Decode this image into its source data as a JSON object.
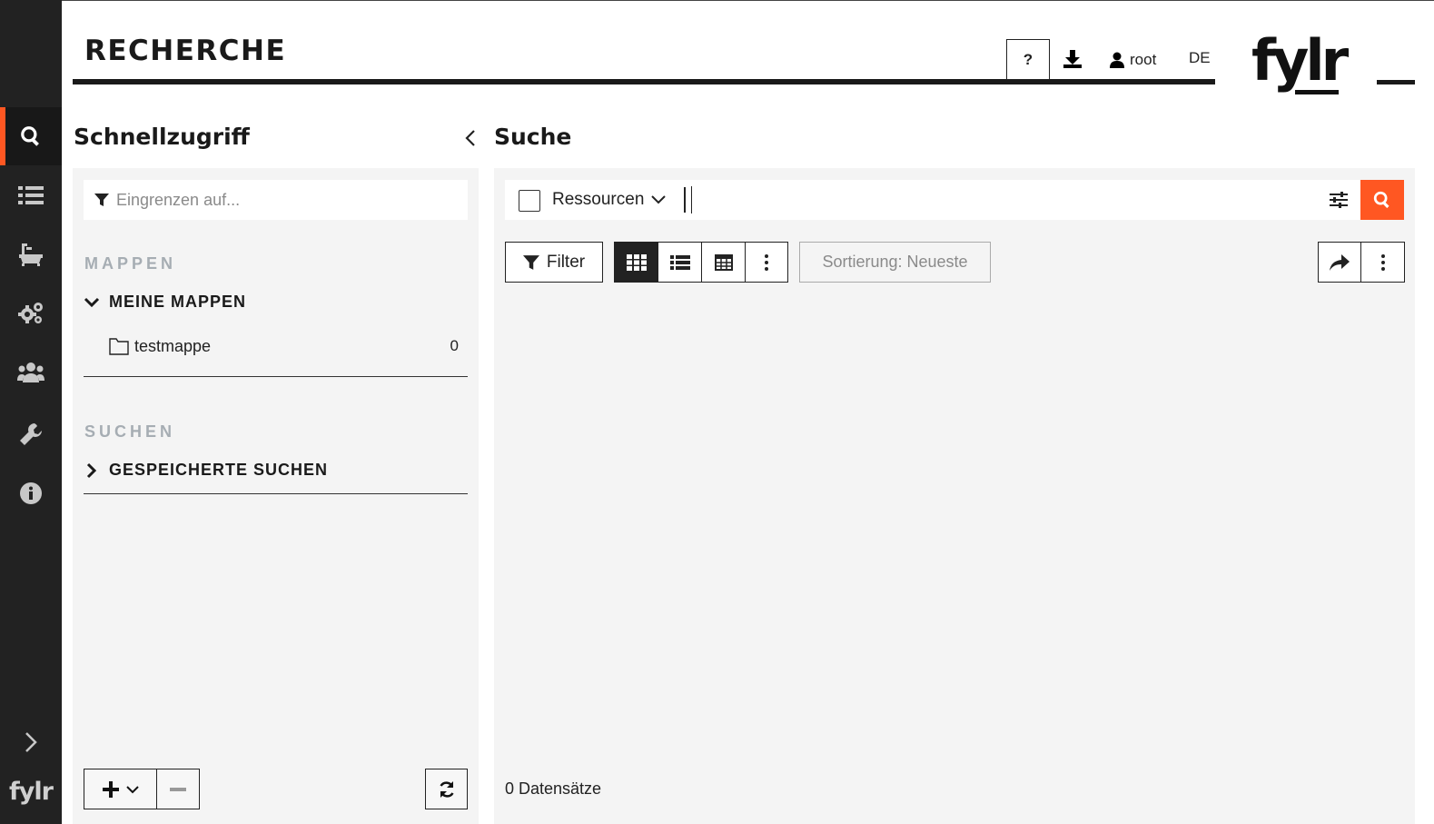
{
  "header": {
    "title": "RECHERCHE",
    "help_label": "?",
    "user_name": "root",
    "language": "DE",
    "brand": "fylr"
  },
  "rail": {
    "items": [
      "search-icon",
      "list-icon",
      "bathtub-icon",
      "cogs-icon",
      "users-icon",
      "wrench-icon",
      "info-icon"
    ],
    "active": "search-icon",
    "logo": "fylr"
  },
  "quick_access": {
    "title": "Schnellzugriff",
    "filter_placeholder": "Eingrenzen auf...",
    "folders_section": "MAPPEN",
    "my_folders_label": "MEINE MAPPEN",
    "folders": [
      {
        "name": "testmappe",
        "count": "0"
      }
    ],
    "searches_section": "SUCHEN",
    "saved_searches_label": "GESPEICHERTE SUCHEN"
  },
  "search": {
    "title": "Suche",
    "type_select": "Ressourcen",
    "filter_label": "Filter",
    "sort_label": "Sortierung: Neueste",
    "records_count": "0 Datensätze"
  },
  "colors": {
    "accent": "#ff5722",
    "rail_bg": "#222222",
    "panel_bg": "#f4f4f4",
    "section_label": "#a6adb3"
  }
}
